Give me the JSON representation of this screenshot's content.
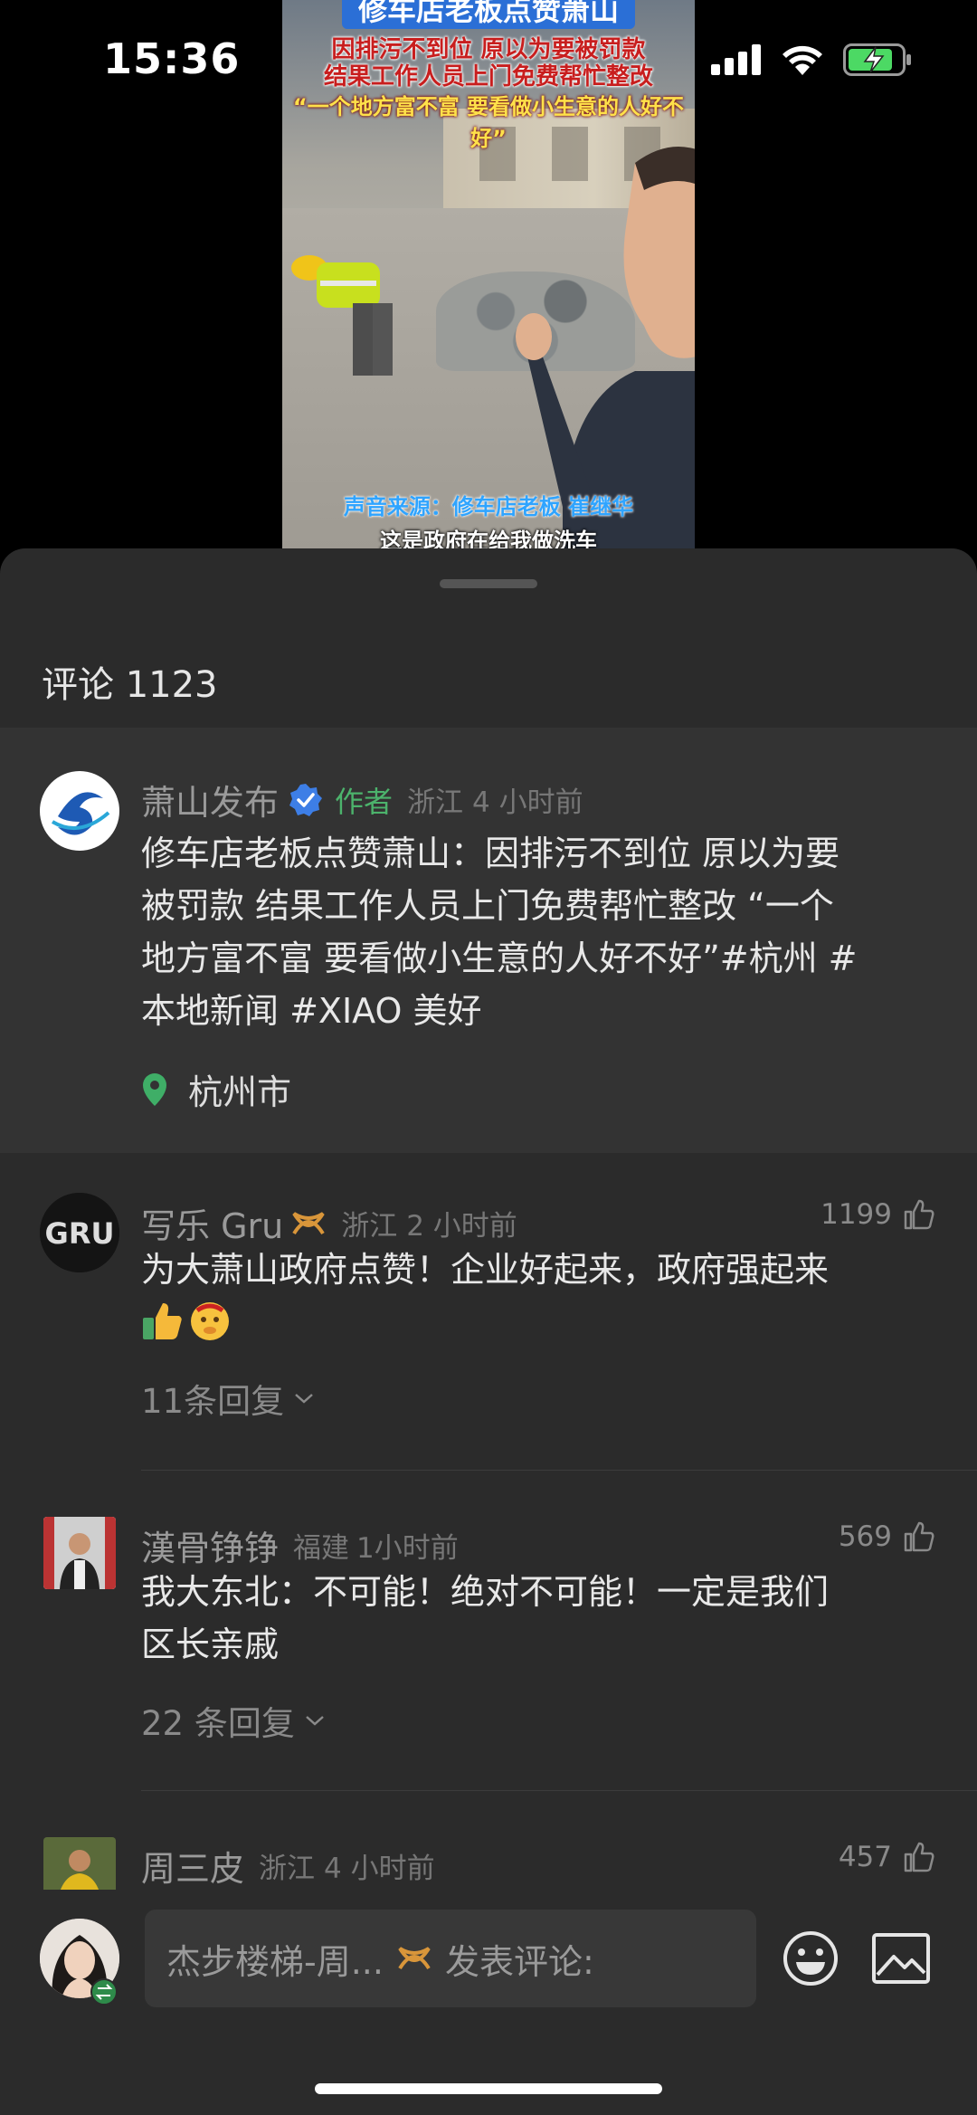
{
  "status": {
    "time": "15:36"
  },
  "video": {
    "title": "修车店老板点赞萧山",
    "caption_line1": "因排污不到位 原以为要被罚款",
    "caption_line2": "结果工作人员上门免费帮忙整改",
    "caption_line3": "“一个地方富不富 要看做小生意的人好不好”",
    "source": "声音来源：修车店老板 崔继华",
    "subtitle": "这是政府在给我做洗车"
  },
  "comments_panel": {
    "title": "评论 1123",
    "author_post": {
      "username": "萧山发布",
      "badge": "作者",
      "location": "浙江",
      "time": "4 小时前",
      "text_lines": [
        "修车店老板点赞萧山：因排污不到位 原以为要",
        "被罚款 结果工作人员上门免费帮忙整改 “一个",
        "地方富不富  要看做小生意的人好不好”#杭州 #",
        "本地新闻 #XIAO 美好"
      ],
      "place": "杭州市"
    },
    "comments": [
      {
        "username": "写乐 Gru",
        "location": "浙江",
        "time": "2 小时前",
        "likes": "1199",
        "text_lines": [
          "为大萧山政府点赞！企业好起来，政府强起来"
        ],
        "replies": "11条回复"
      },
      {
        "username": "漢骨铮铮",
        "location": "福建",
        "time": "1小时前",
        "likes": "569",
        "text_lines": [
          "我大东北：不可能！绝对不可能！一定是我们",
          "区长亲戚"
        ],
        "replies": "22 条回复"
      },
      {
        "username": "周三皮",
        "location": "浙江",
        "time": "4 小时前",
        "likes": "457"
      }
    ]
  },
  "input": {
    "user_prefix": "杰步楼梯-周...",
    "placeholder": "发表评论:"
  },
  "icons": {
    "verified": "verified-badge-icon",
    "location": "location-pin-icon",
    "like": "thumbs-up-icon",
    "emoji": "emoji-icon",
    "image": "image-icon",
    "accent_green": "#4cb36c",
    "accent_gold": "#d9963a"
  }
}
